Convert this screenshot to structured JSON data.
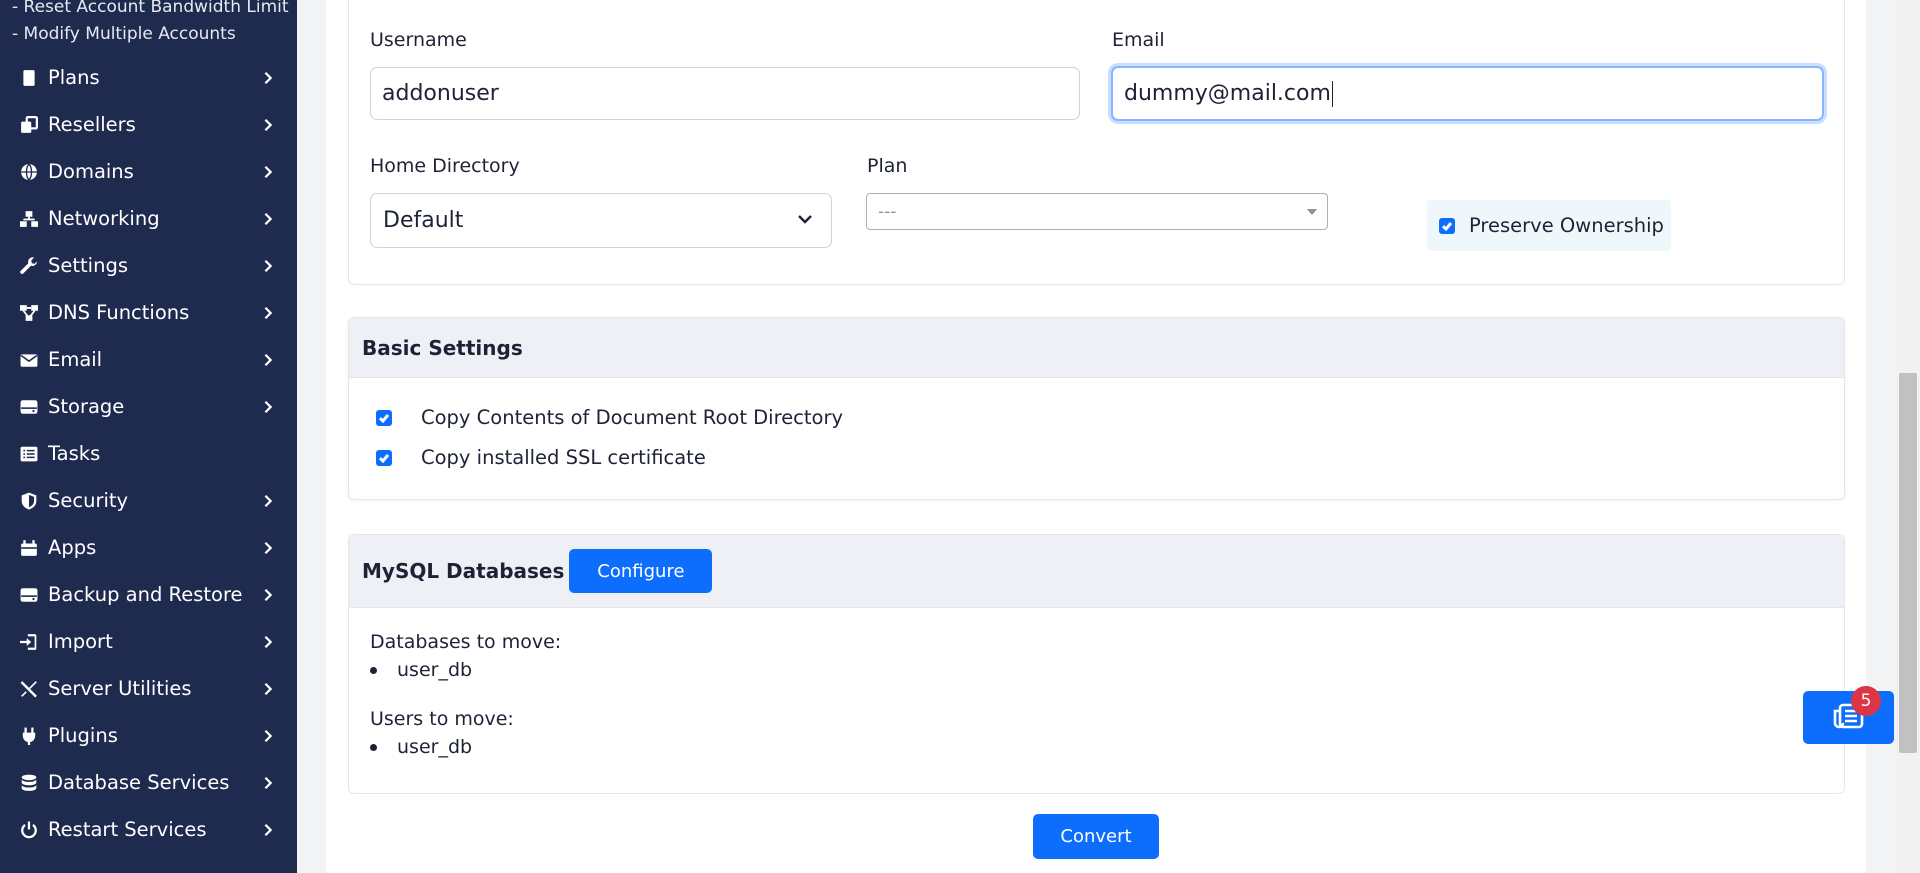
{
  "sidebar": {
    "sub_items": [
      "- Reset Account Bandwidth Limit",
      "- Modify Multiple Accounts"
    ],
    "items": [
      {
        "label": "Plans",
        "icon": "plans-icon"
      },
      {
        "label": "Resellers",
        "icon": "resellers-icon"
      },
      {
        "label": "Domains",
        "icon": "globe-icon"
      },
      {
        "label": "Networking",
        "icon": "network-icon"
      },
      {
        "label": "Settings",
        "icon": "wrench-icon"
      },
      {
        "label": "DNS Functions",
        "icon": "dns-icon"
      },
      {
        "label": "Email",
        "icon": "envelope-icon"
      },
      {
        "label": "Storage",
        "icon": "storage-icon"
      },
      {
        "label": "Tasks",
        "icon": "list-icon"
      },
      {
        "label": "Security",
        "icon": "shield-icon"
      },
      {
        "label": "Apps",
        "icon": "apps-icon"
      },
      {
        "label": "Backup and Restore",
        "icon": "backup-icon"
      },
      {
        "label": "Import",
        "icon": "import-icon"
      },
      {
        "label": "Server Utilities",
        "icon": "tools-icon"
      },
      {
        "label": "Plugins",
        "icon": "plug-icon"
      },
      {
        "label": "Database Services",
        "icon": "database-icon"
      },
      {
        "label": "Restart Services",
        "icon": "power-icon"
      }
    ]
  },
  "account_form": {
    "username_label": "Username",
    "username_value": "addonuser",
    "email_label": "Email",
    "email_value": "dummy@mail.com",
    "home_dir_label": "Home Directory",
    "home_dir_value": "Default",
    "plan_label": "Plan",
    "plan_value": "---",
    "preserve_ownership_label": "Preserve Ownership",
    "preserve_ownership_checked": true
  },
  "basic_settings": {
    "title": "Basic Settings",
    "options": [
      {
        "label": "Copy Contents of Document Root Directory",
        "checked": true
      },
      {
        "label": "Copy installed SSL certificate",
        "checked": true
      }
    ]
  },
  "mysql": {
    "title": "MySQL Databases",
    "configure_label": "Configure",
    "databases_label": "Databases to move:",
    "databases": [
      "user_db"
    ],
    "users_label": "Users to move:",
    "users": [
      "user_db"
    ]
  },
  "convert_label": "Convert",
  "notification_badge": "5",
  "colors": {
    "sidebar_bg": "#1f2a4f",
    "primary": "#0d6efd",
    "badge": "#dc3545"
  }
}
